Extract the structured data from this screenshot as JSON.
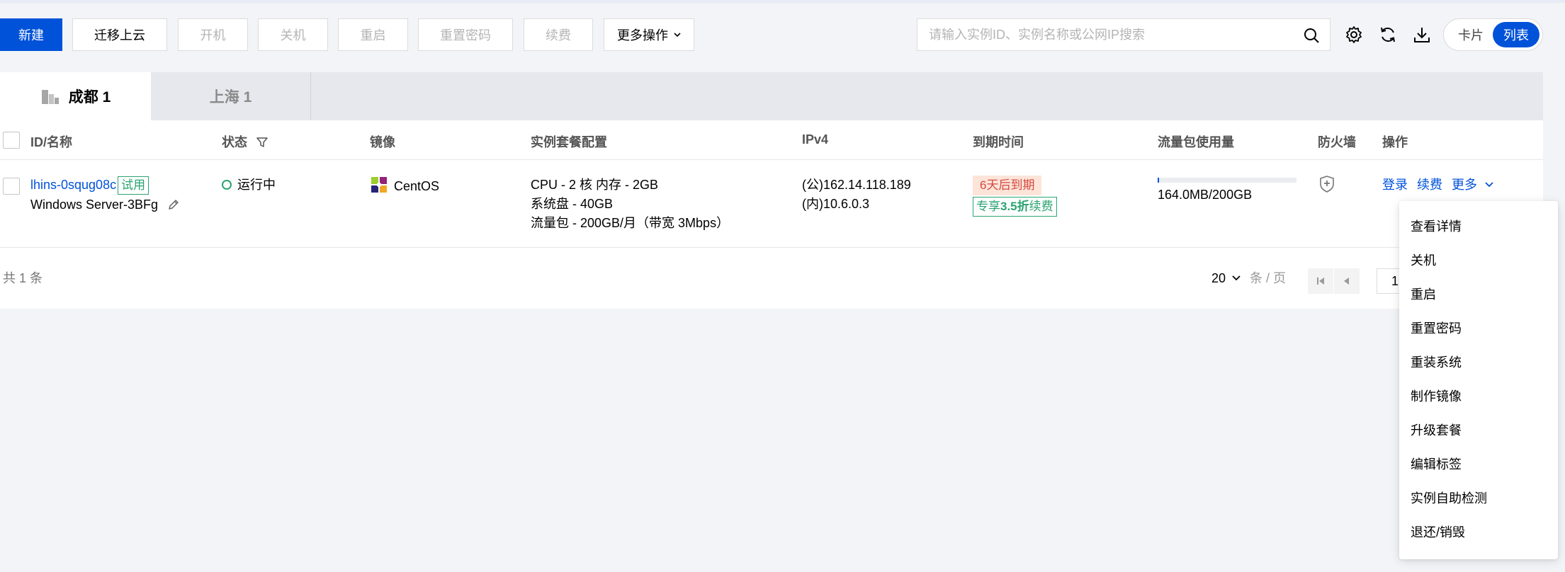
{
  "toolbar": {
    "new": "新建",
    "migrate": "迁移上云",
    "start": "开机",
    "shutdown": "关机",
    "restart": "重启",
    "reset_password": "重置密码",
    "renew": "续费",
    "more_actions": "更多操作"
  },
  "search": {
    "placeholder": "请输入实例ID、实例名称或公网IP搜索"
  },
  "view_toggle": {
    "card": "卡片",
    "list": "列表",
    "active": "list"
  },
  "tabs": [
    {
      "label": "成都 1",
      "active": true
    },
    {
      "label": "上海 1",
      "active": false
    }
  ],
  "table": {
    "headers": {
      "id_name": "ID/名称",
      "status": "状态",
      "image": "镜像",
      "config": "实例套餐配置",
      "ipv4": "IPv4",
      "expire": "到期时间",
      "traffic": "流量包使用量",
      "firewall": "防火墙",
      "actions": "操作"
    },
    "rows": [
      {
        "id": "lhins-0squg08c",
        "trial_tag": "试用",
        "name": "Windows Server-3BFg",
        "status": "运行中",
        "image": "CentOS",
        "config": [
          "CPU - 2 核 内存 - 2GB",
          "系统盘 - 40GB",
          "流量包 - 200GB/月（带宽 3Mbps）"
        ],
        "ip_public": "(公)162.14.118.189",
        "ip_private": "(内)10.6.0.3",
        "expire_badge": "6天后到期",
        "discount": {
          "prefix": "专享",
          "value": "3.5折",
          "suffix": "续费"
        },
        "traffic_text": "164.0MB/200GB",
        "traffic_fraction": 0.0008,
        "actions": {
          "login": "登录",
          "renew": "续费",
          "more": "更多"
        }
      }
    ]
  },
  "footer": {
    "total": "共 1 条",
    "page_size": "20",
    "per_page": "条 / 页",
    "page": "1"
  },
  "more_menu": {
    "items": [
      "查看详情",
      "关机",
      "重启",
      "重置密码",
      "重装系统",
      "制作镜像",
      "升级套餐",
      "编辑标签",
      "实例自助检测",
      "退还/销毁"
    ]
  },
  "colors": {
    "primary": "#0052d9",
    "success": "#2ba471",
    "warning_bg": "#fde4d8",
    "warning_text": "#d54941",
    "background": "#f3f4f7"
  }
}
